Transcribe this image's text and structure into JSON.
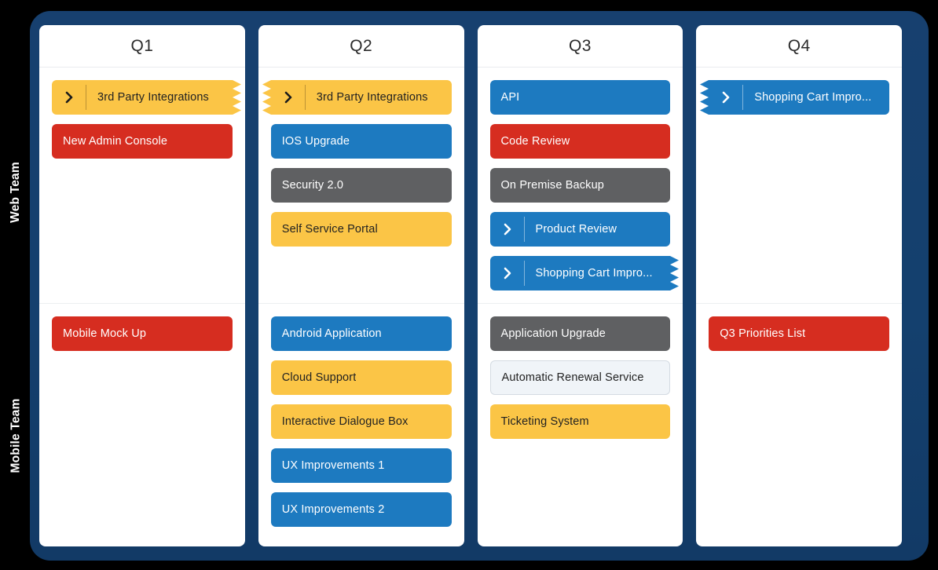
{
  "board": {
    "accent_panel_color": "#17406f",
    "background_color": "#000000",
    "row_labels": [
      {
        "id": "web-team",
        "label": "Web Team"
      },
      {
        "id": "mobile-team",
        "label": "Mobile Team"
      }
    ],
    "colors": {
      "blue": "#1d7ac0",
      "red": "#d62d20",
      "gray": "#5f6062",
      "yellow": "#fbc546",
      "white": "#f0f4f8"
    },
    "columns": [
      {
        "id": "q1",
        "title": "Q1",
        "web": [
          {
            "label": "3rd Party Integrations",
            "color": "yellow",
            "chevron": true,
            "zigzag": "right"
          },
          {
            "label": "New Admin Console",
            "color": "red",
            "chevron": false,
            "zigzag": "none"
          }
        ],
        "mobile": [
          {
            "label": "Mobile Mock Up",
            "color": "red",
            "chevron": false,
            "zigzag": "none"
          }
        ]
      },
      {
        "id": "q2",
        "title": "Q2",
        "web": [
          {
            "label": "3rd Party Integrations",
            "color": "yellow",
            "chevron": true,
            "zigzag": "left"
          },
          {
            "label": "IOS Upgrade",
            "color": "blue",
            "chevron": false,
            "zigzag": "none"
          },
          {
            "label": "Security 2.0",
            "color": "gray",
            "chevron": false,
            "zigzag": "none"
          },
          {
            "label": "Self Service Portal",
            "color": "yellow",
            "chevron": false,
            "zigzag": "none"
          }
        ],
        "mobile": [
          {
            "label": "Android Application",
            "color": "blue",
            "chevron": false,
            "zigzag": "none"
          },
          {
            "label": "Cloud Support",
            "color": "yellow",
            "chevron": false,
            "zigzag": "none"
          },
          {
            "label": "Interactive Dialogue Box",
            "color": "yellow",
            "chevron": false,
            "zigzag": "none"
          },
          {
            "label": "UX Improvements 1",
            "color": "blue",
            "chevron": false,
            "zigzag": "none"
          },
          {
            "label": "UX Improvements 2",
            "color": "blue",
            "chevron": false,
            "zigzag": "none"
          }
        ]
      },
      {
        "id": "q3",
        "title": "Q3",
        "web": [
          {
            "label": "API",
            "color": "blue",
            "chevron": false,
            "zigzag": "none"
          },
          {
            "label": "Code Review",
            "color": "red",
            "chevron": false,
            "zigzag": "none"
          },
          {
            "label": "On Premise Backup",
            "color": "gray",
            "chevron": false,
            "zigzag": "none"
          },
          {
            "label": "Product Review",
            "color": "blue",
            "chevron": true,
            "zigzag": "none"
          },
          {
            "label": "Shopping Cart Impro...",
            "color": "blue",
            "chevron": true,
            "zigzag": "right"
          }
        ],
        "mobile": [
          {
            "label": "Application Upgrade",
            "color": "gray",
            "chevron": false,
            "zigzag": "none"
          },
          {
            "label": "Automatic Renewal Service",
            "color": "white",
            "chevron": false,
            "zigzag": "none"
          },
          {
            "label": "Ticketing System",
            "color": "yellow",
            "chevron": false,
            "zigzag": "none"
          }
        ]
      },
      {
        "id": "q4",
        "title": "Q4",
        "web": [
          {
            "label": "Shopping Cart Impro...",
            "color": "blue",
            "chevron": true,
            "zigzag": "left"
          }
        ],
        "mobile": [
          {
            "label": "Q3 Priorities List",
            "color": "red",
            "chevron": false,
            "zigzag": "none"
          }
        ]
      }
    ]
  }
}
